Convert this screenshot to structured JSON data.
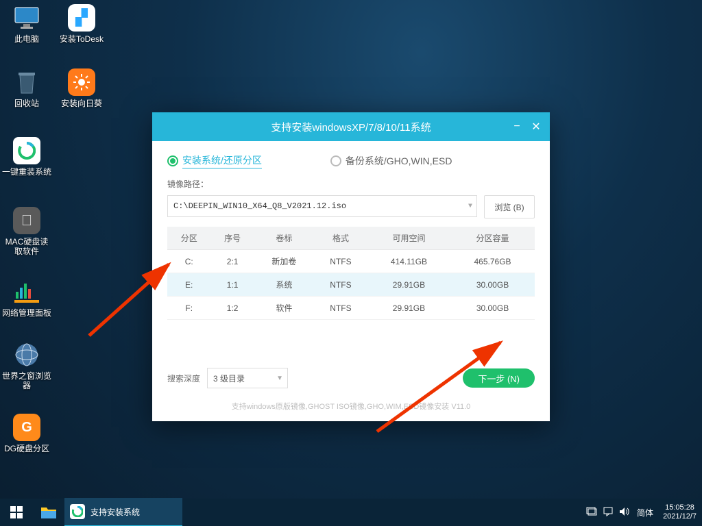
{
  "desktop": {
    "icons": [
      {
        "label": "此电脑",
        "color": "#2c6aa0"
      },
      {
        "label": "安装ToDesk",
        "color": "#ffffff"
      },
      {
        "label": "回收站",
        "color": "#3a4a58"
      },
      {
        "label": "安装向日葵",
        "color": "#ff7a1a"
      },
      {
        "label": "一键重装系统",
        "color": "#ffffff"
      },
      {
        "label": "MAC硬盘读\n取软件",
        "color": "#5a5a5a"
      },
      {
        "label": "网络管理面板",
        "color": "#0a1e30"
      },
      {
        "label": "世界之窗浏览\n器",
        "color": "#3a6a9a"
      },
      {
        "label": "DG硬盘分区",
        "color": "#ff8a1a"
      }
    ]
  },
  "window": {
    "title": "支持安装windowsXP/7/8/10/11系统",
    "tab_install": "安装系统/还原分区",
    "tab_backup": "备份系统/GHO,WIN,ESD",
    "path_label": "镜像路径：",
    "path_value": "C:\\DEEPIN_WIN10_X64_Q8_V2021.12.iso",
    "browse": "浏览 (B)",
    "columns": [
      "分区",
      "序号",
      "卷标",
      "格式",
      "可用空间",
      "分区容量"
    ],
    "rows": [
      {
        "part": "C:",
        "idx": "2:1",
        "label": "新加卷",
        "fs": "NTFS",
        "free": "414.11GB",
        "total": "465.76GB",
        "sel": false
      },
      {
        "part": "E:",
        "idx": "1:1",
        "label": "系统",
        "fs": "NTFS",
        "free": "29.91GB",
        "total": "30.00GB",
        "sel": true
      },
      {
        "part": "F:",
        "idx": "1:2",
        "label": "软件",
        "fs": "NTFS",
        "free": "29.91GB",
        "total": "30.00GB",
        "sel": false
      }
    ],
    "depth_label": "搜索深度",
    "depth_value": "3 级目录",
    "next": "下一步 (N)",
    "footer": "支持windows原版镜像,GHOST ISO镜像,GHO,WIM,ESD镜像安装 V11.0"
  },
  "taskbar": {
    "task_label": "支持安装系统",
    "ime": "简体",
    "time": "15:05:28",
    "date": "2021/12/7"
  }
}
